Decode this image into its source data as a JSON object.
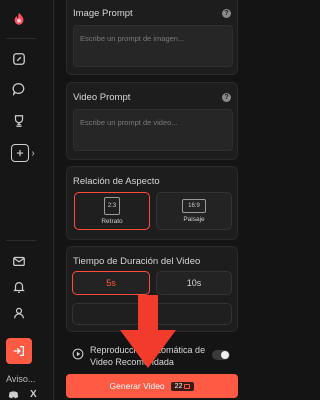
{
  "sidebar": {
    "items": [
      {
        "name": "logo",
        "icon": "flame-logo-icon"
      },
      {
        "name": "edit",
        "icon": "edit-icon"
      },
      {
        "name": "chat",
        "icon": "chat-icon"
      },
      {
        "name": "trophy",
        "icon": "trophy-icon"
      },
      {
        "name": "create",
        "icon": "plus-square-icon",
        "chevron": "›"
      },
      {
        "name": "mail",
        "icon": "mail-icon"
      },
      {
        "name": "notifications",
        "icon": "bell-icon"
      },
      {
        "name": "user",
        "icon": "user-icon"
      }
    ],
    "aviso_label": "Aviso...",
    "social_icons": [
      "discord-icon",
      "x-icon"
    ],
    "social_x_label": "X",
    "accent": "#ff5a44"
  },
  "image_prompt": {
    "title": "Image Prompt",
    "placeholder": "Escribe un prompt de imagen..."
  },
  "video_prompt": {
    "title": "Video Prompt",
    "placeholder": "Escribe un prompt de video..."
  },
  "aspect": {
    "title": "Relación de Aspecto",
    "options": [
      {
        "ratio": "2:3",
        "label": "Retrato",
        "selected": true
      },
      {
        "ratio": "16:9",
        "label": "Paisaje",
        "selected": false
      }
    ]
  },
  "duration": {
    "title": "Tiempo de Duración del Video",
    "options": [
      {
        "label": "5s",
        "selected": true
      },
      {
        "label": "10s",
        "selected": false
      }
    ]
  },
  "autoplay": {
    "label": "Reproducción Automática de Video Recomendada",
    "enabled": false
  },
  "generate": {
    "label": "Generar Video",
    "cost": "22"
  }
}
